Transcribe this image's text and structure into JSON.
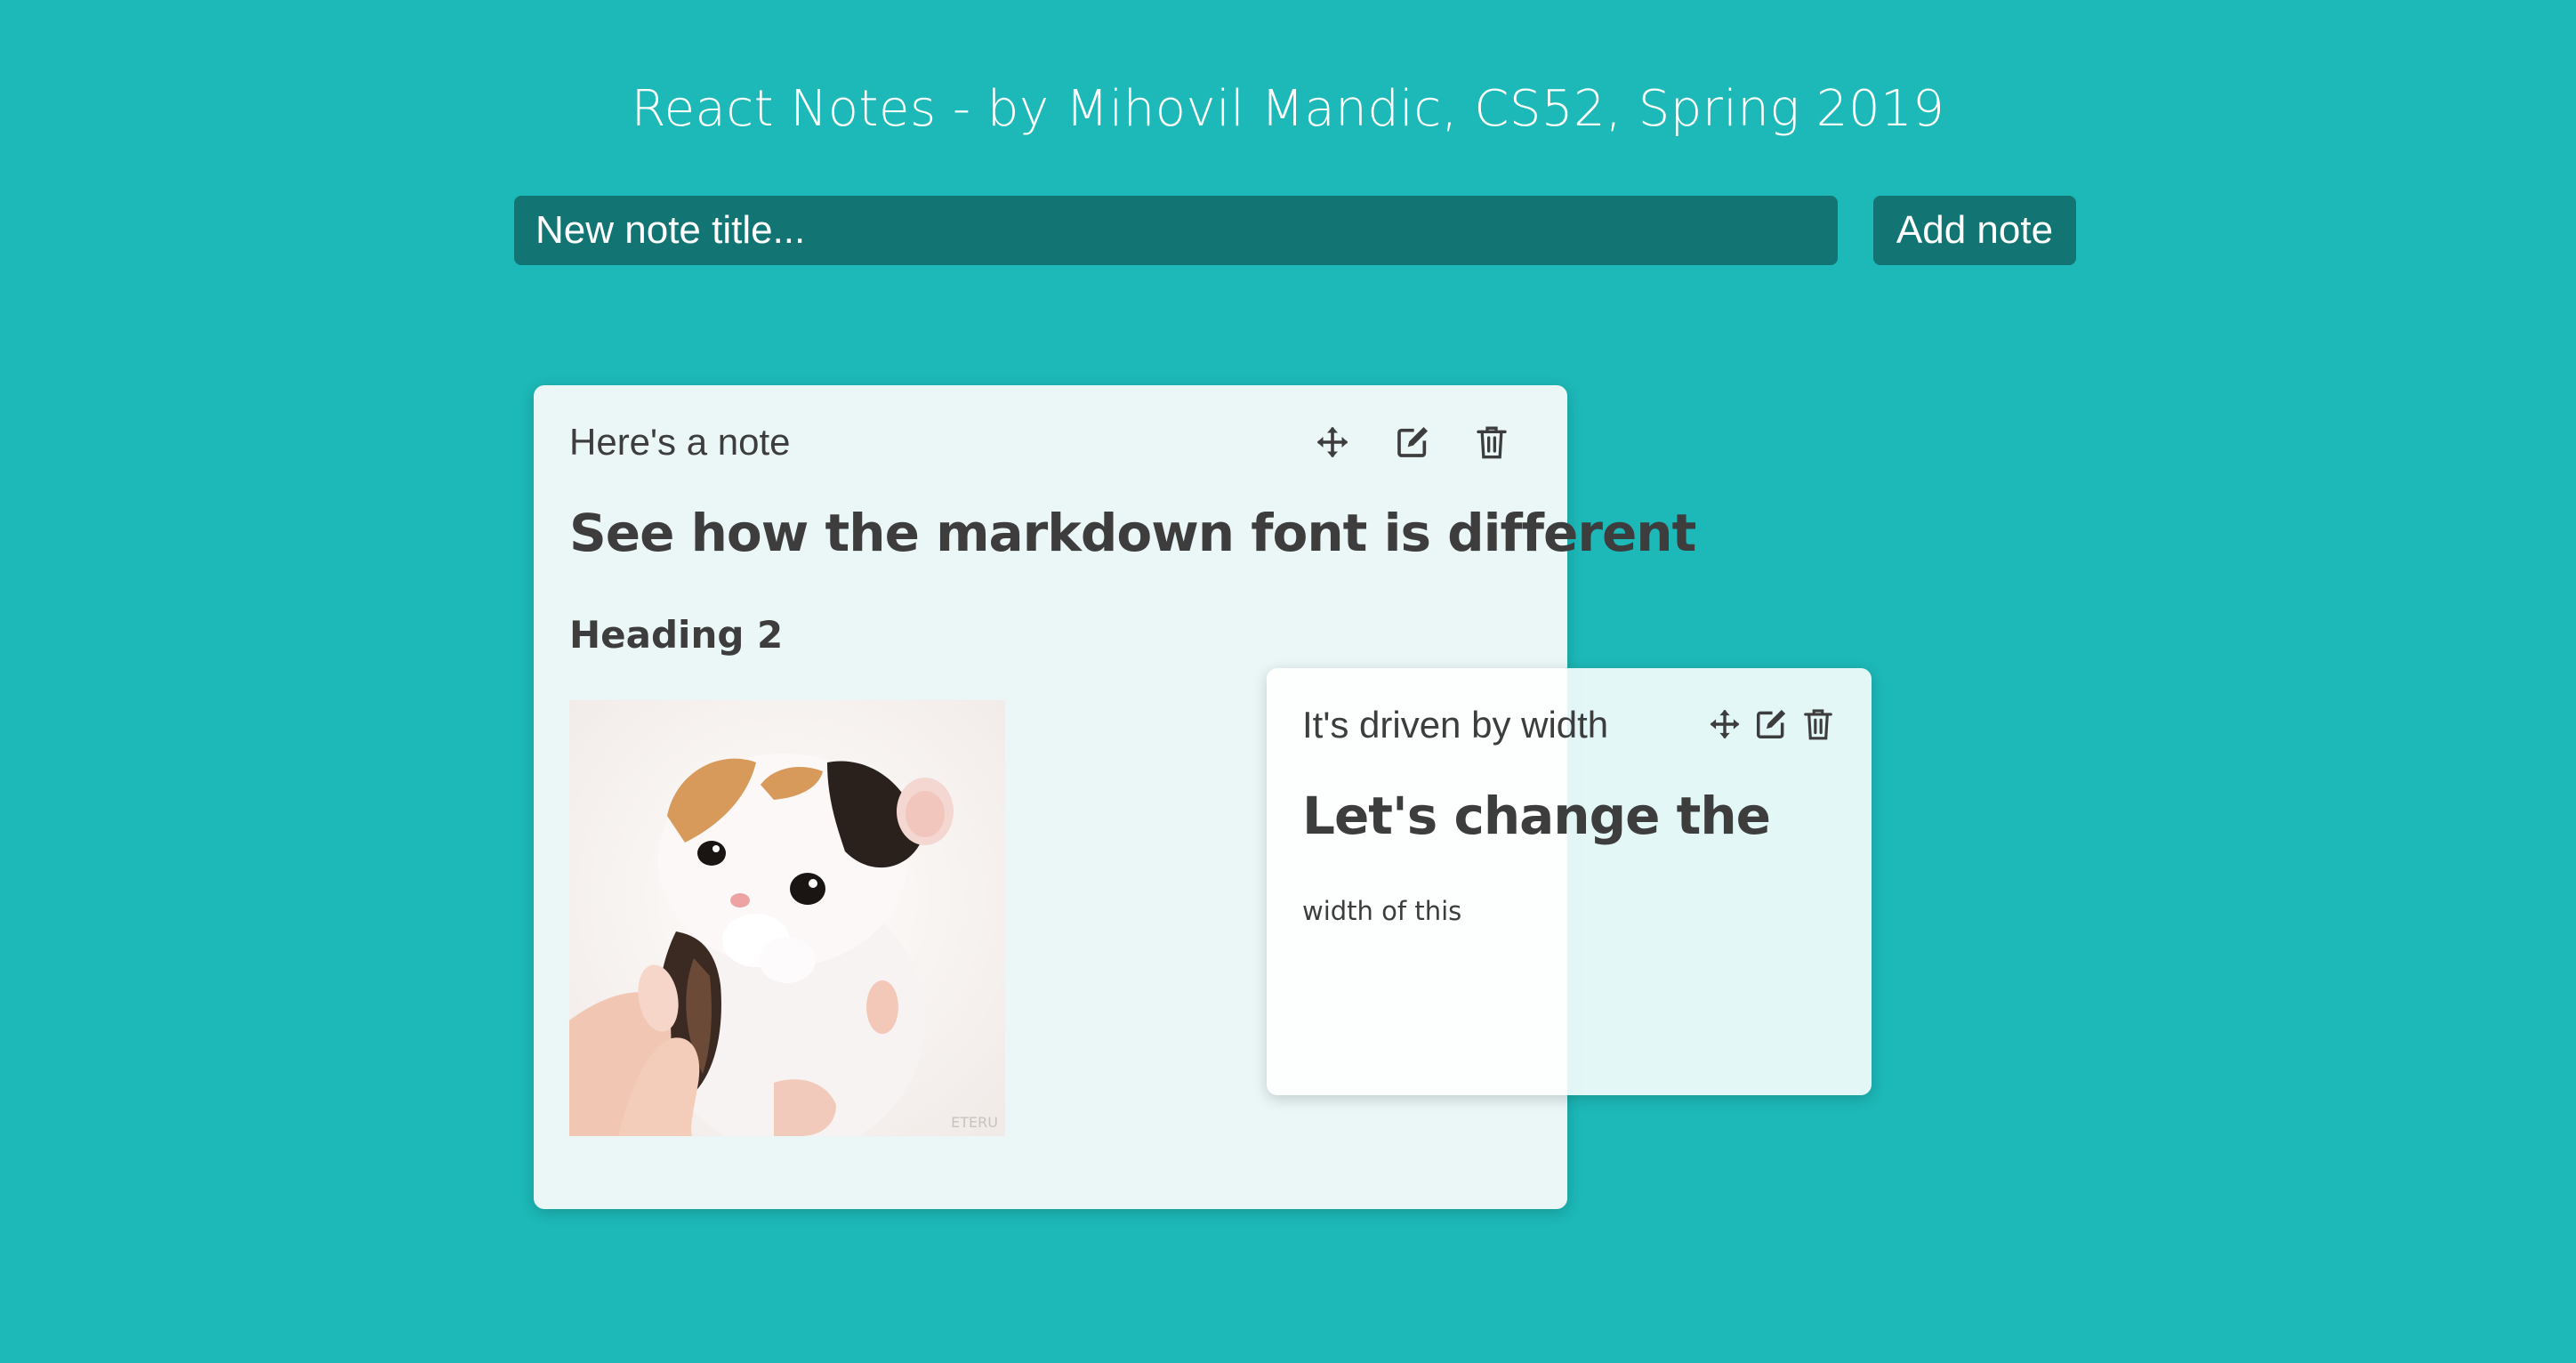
{
  "header": {
    "title": "React Notes - by Mihovil Mandic, CS52, Spring 2019"
  },
  "new_note": {
    "placeholder": "New note title...",
    "add_label": "Add note"
  },
  "colors": {
    "background": "#1db8b8",
    "control": "#137573",
    "note_background": "#ebf7f7",
    "text": "#3d3d3d"
  },
  "notes": [
    {
      "title": "Here's a note",
      "content": {
        "h1": "See how the markdown font is different",
        "h2": "Heading 2",
        "image": {
          "subject": "kitten-photo",
          "watermark": "ETERU"
        }
      },
      "icons": [
        "move-icon",
        "edit-icon",
        "delete-icon"
      ]
    },
    {
      "title": "It's driven by width",
      "content": {
        "h1": "Let's change the",
        "p": "width of this"
      },
      "icons": [
        "move-icon",
        "edit-icon",
        "delete-icon"
      ]
    }
  ]
}
